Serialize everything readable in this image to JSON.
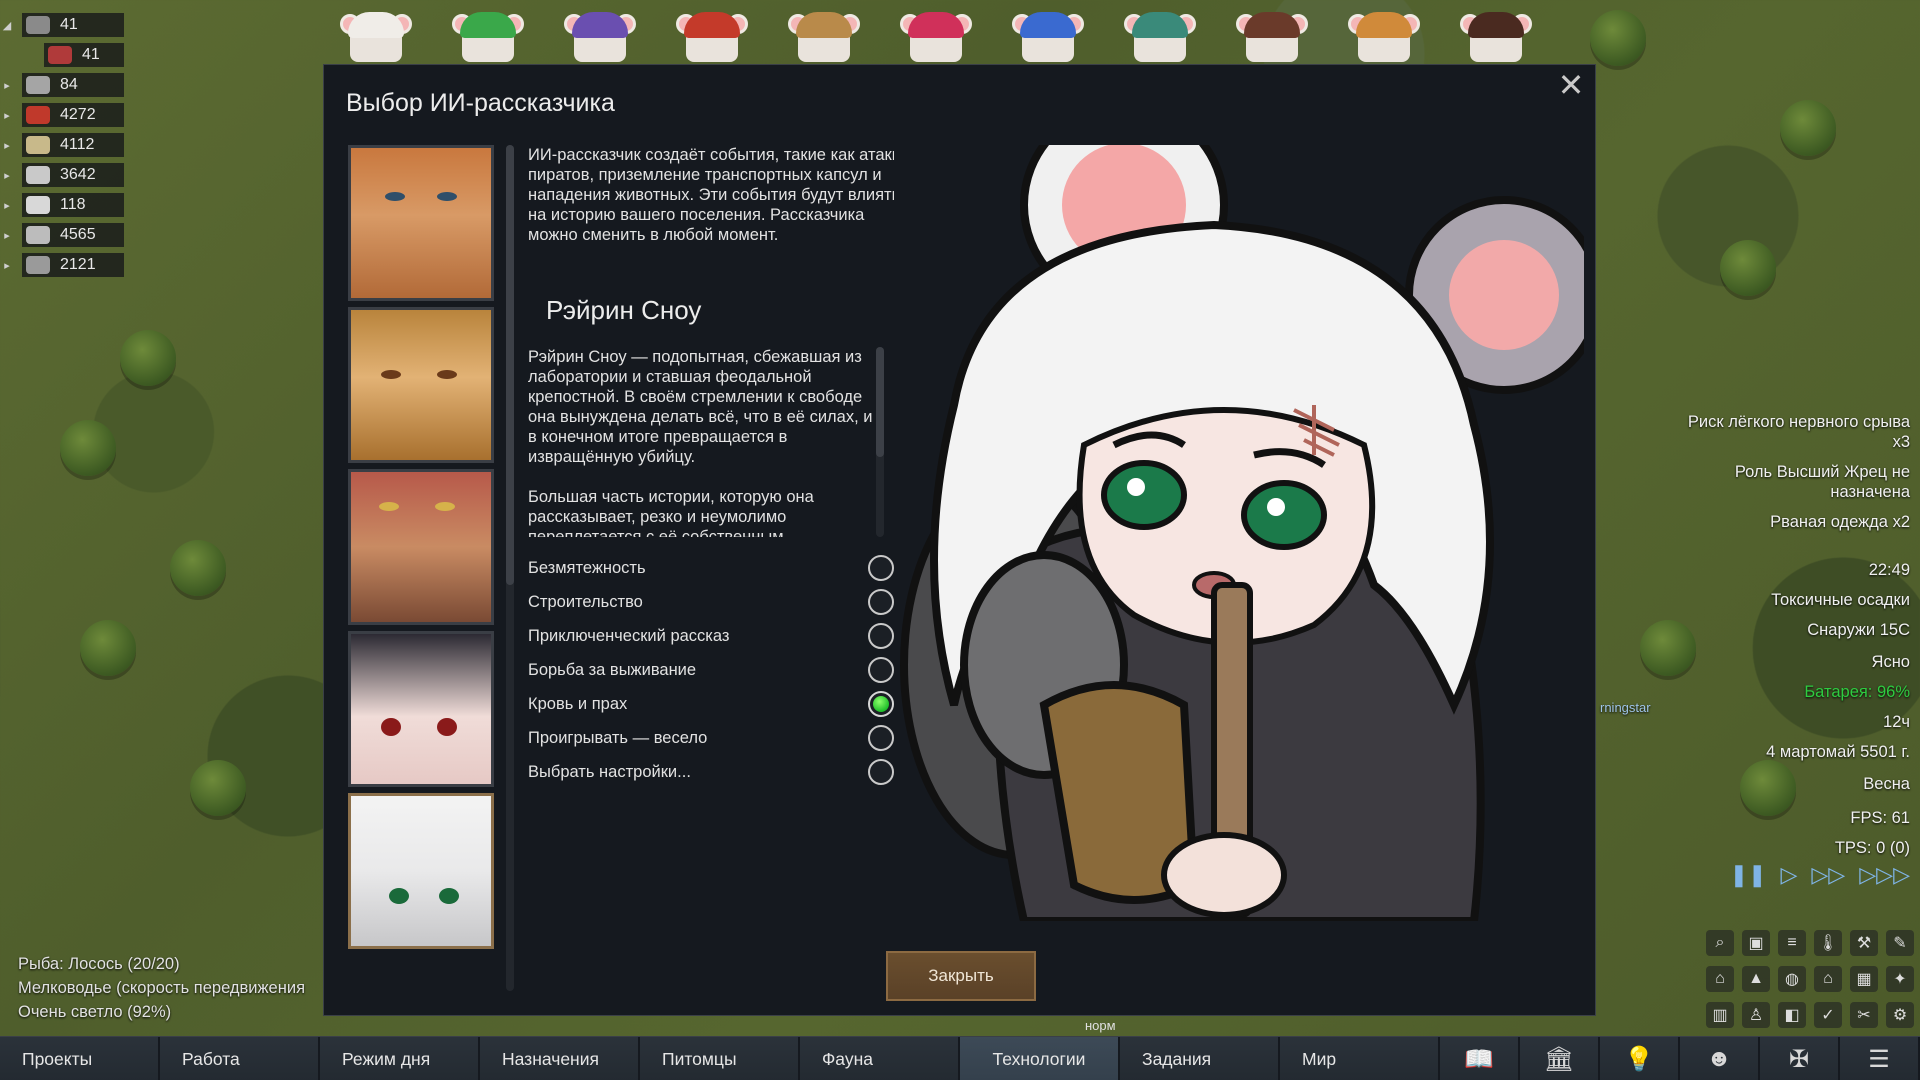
{
  "resources": [
    {
      "value": "41",
      "icon": "cloud-icon",
      "color": "#8a8a8a",
      "sub": false
    },
    {
      "value": "41",
      "icon": "books-icon",
      "color": "#b03a3a",
      "sub": true
    },
    {
      "value": "84",
      "icon": "meat-icon",
      "color": "#a5a5a5",
      "sub": false
    },
    {
      "value": "4272",
      "icon": "berry-icon",
      "color": "#c0392b",
      "sub": false
    },
    {
      "value": "4112",
      "icon": "wood-icon",
      "color": "#c8b98a",
      "sub": false
    },
    {
      "value": "3642",
      "icon": "steel-icon",
      "color": "#c9c9c9",
      "sub": false
    },
    {
      "value": "118",
      "icon": "medicine-icon",
      "color": "#d8d8d8",
      "sub": false
    },
    {
      "value": "4565",
      "icon": "component-icon",
      "color": "#bcbcbc",
      "sub": false
    },
    {
      "value": "2121",
      "icon": "stone-icon",
      "color": "#9a9a9a",
      "sub": false
    }
  ],
  "colonists": [
    {
      "hair": "#f0ede8"
    },
    {
      "hair": "#3aa84a"
    },
    {
      "hair": "#6a4fb0"
    },
    {
      "hair": "#c43a2a"
    },
    {
      "hair": "#b98a4a"
    },
    {
      "hair": "#d0305a"
    },
    {
      "hair": "#3a6ad0"
    },
    {
      "hair": "#3a8a7a"
    },
    {
      "hair": "#6a3a2a"
    },
    {
      "hair": "#d08a3a"
    },
    {
      "hair": "#4a2a20"
    }
  ],
  "dialog": {
    "title": "Выбор ИИ-рассказчика",
    "description": "ИИ-рассказчик создаёт события, такие как атаки пиратов, приземление транспортных капсул и нападения животных. Эти события будут влиять на историю вашего поселения. Рассказчика можно сменить в любой момент.",
    "storyteller_name": "Рэйрин Сноу",
    "bio_1": "Рэйрин Сноу — подопытная, сбежавшая из лаборатории и ставшая феодальной крепостной. В своём стремлении к свободе она вынуждена делать всё, что в её силах, и в конечном итоге превращается в извращённую убийцу.",
    "bio_2": "Большая часть истории, которую она рассказывает, резко и неумолимо переплетается с её собственным",
    "options": [
      {
        "label": "Безмятежность",
        "selected": false
      },
      {
        "label": "Строительство",
        "selected": false
      },
      {
        "label": "Приключенческий рассказ",
        "selected": false
      },
      {
        "label": "Борьба за выживание",
        "selected": false
      },
      {
        "label": "Кровь и прах",
        "selected": true
      },
      {
        "label": "Проигрывать — весело",
        "selected": false
      },
      {
        "label": "Выбрать настройки...",
        "selected": false
      }
    ],
    "close_button": "Закрыть",
    "close_x": "✕"
  },
  "right_info": {
    "alert_1": "Риск лёгкого нервного срыва x3",
    "alert_2": "Роль Высший Жрец не назначена",
    "alert_3": "Рваная одежда x2",
    "time": "22:49",
    "weather_event": "Токсичные осадки",
    "outside_temp": "Снаружи 15C",
    "weather": "Ясно",
    "battery": "Батарея: 96%",
    "battery_color": "#2ecc40",
    "hour": "12ч",
    "date": "4 мартомай 5501 г.",
    "season": "Весна",
    "fps": "FPS: 61",
    "tps": "TPS: 0 (0)",
    "pawn_label": "rningstar"
  },
  "bottom_left": {
    "line1": "Рыба: Лосось (20/20)",
    "line2": "Мелководье (скорость передвижения",
    "line3": "Очень светло (92%)",
    "speed_label": "норм"
  },
  "bottom_tabs": [
    {
      "label": "Проекты",
      "active": false
    },
    {
      "label": "Работа",
      "active": false
    },
    {
      "label": "Режим дня",
      "active": false
    },
    {
      "label": "Назначения",
      "active": false
    },
    {
      "label": "Питомцы",
      "active": false
    },
    {
      "label": "Фауна",
      "active": false
    },
    {
      "label": "Технологии",
      "active": true
    },
    {
      "label": "Задания",
      "active": false
    },
    {
      "label": "Мир",
      "active": false
    }
  ],
  "bottom_icons": [
    "book-icon",
    "building-icon",
    "lightbulb-icon",
    "head-icon",
    "ideology-icon",
    "menu-icon"
  ]
}
